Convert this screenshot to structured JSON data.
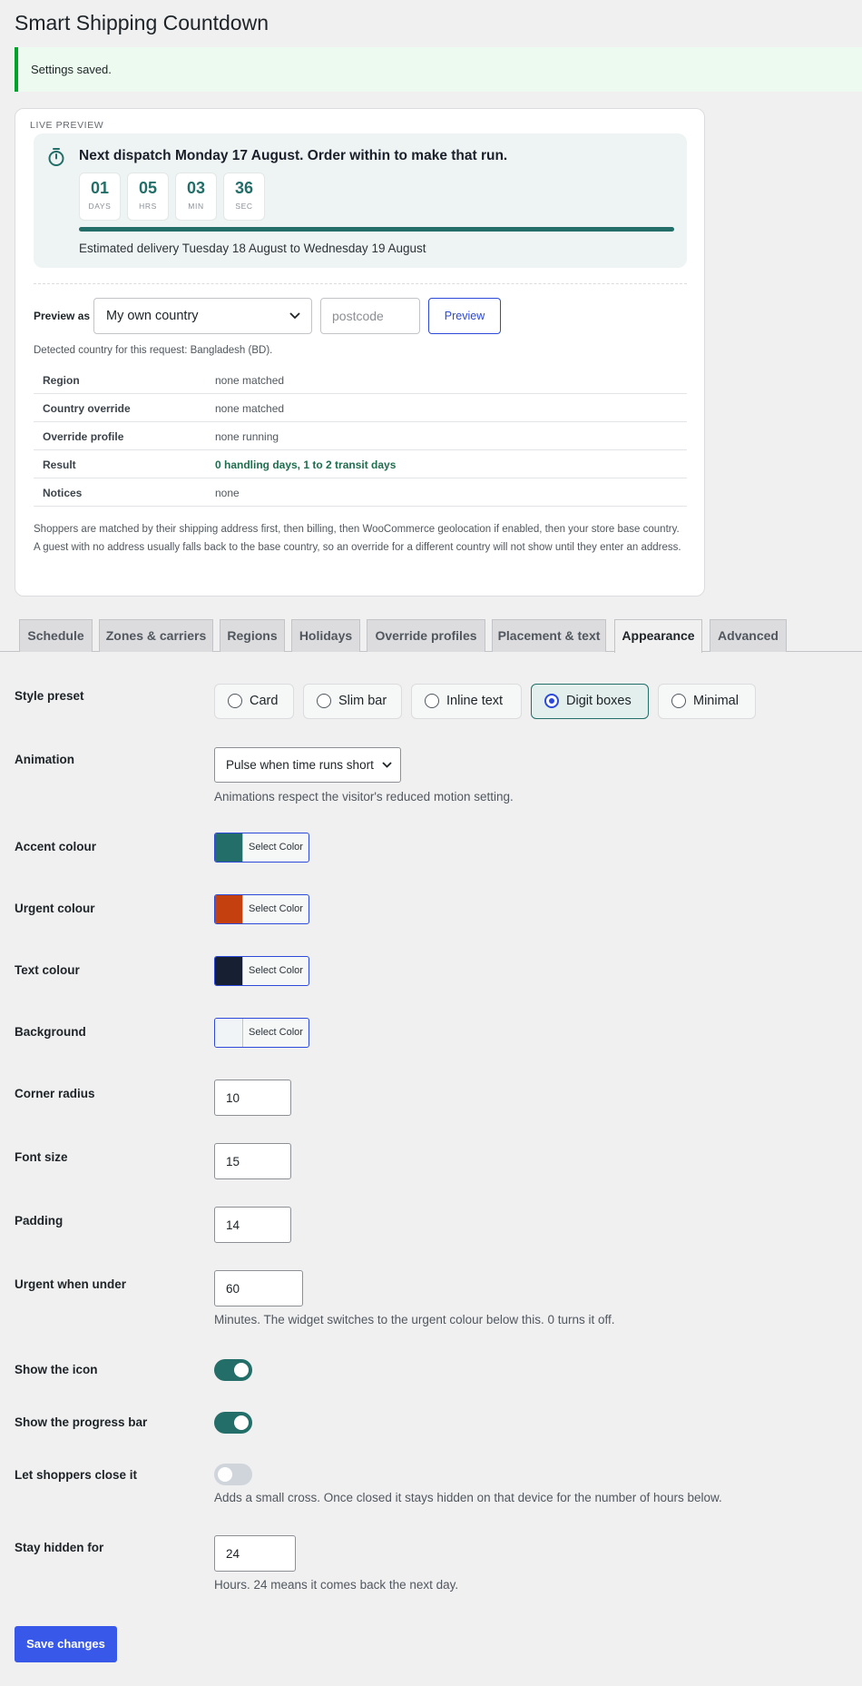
{
  "page": {
    "title": "Smart Shipping Countdown"
  },
  "notice": {
    "text": "Settings saved."
  },
  "preview": {
    "section_label": "LIVE PREVIEW",
    "headline": "Next dispatch Monday 17 August. Order within to make that run.",
    "countdown": [
      {
        "value": "01",
        "unit": "DAYS"
      },
      {
        "value": "05",
        "unit": "HRS"
      },
      {
        "value": "03",
        "unit": "MIN"
      },
      {
        "value": "36",
        "unit": "SEC"
      }
    ],
    "progress_percent": 100,
    "estimate": "Estimated delivery Tuesday 18 August to Wednesday 19 August",
    "preview_as_label": "Preview as",
    "country_value": "My own country",
    "postcode_placeholder": "postcode",
    "preview_button": "Preview",
    "detected": "Detected country for this request: Bangladesh (BD).",
    "info": [
      {
        "key": "Region",
        "value": "none matched"
      },
      {
        "key": "Country override",
        "value": "none matched"
      },
      {
        "key": "Override profile",
        "value": "none running"
      },
      {
        "key": "Result",
        "value": "0 handling days, 1 to 2 transit days"
      },
      {
        "key": "Notices",
        "value": "none"
      }
    ],
    "footnote": "Shoppers are matched by their shipping address first, then billing, then WooCommerce geolocation if enabled, then your store base country. A guest with no address usually falls back to the base country, so an override for a different country will not show until they enter an address."
  },
  "tabs": [
    {
      "label": "Schedule"
    },
    {
      "label": "Zones & carriers"
    },
    {
      "label": "Regions"
    },
    {
      "label": "Holidays"
    },
    {
      "label": "Override profiles"
    },
    {
      "label": "Placement & text"
    },
    {
      "label": "Appearance",
      "active": true
    },
    {
      "label": "Advanced"
    }
  ],
  "settings": {
    "style_preset": {
      "label": "Style preset",
      "options": [
        "Card",
        "Slim bar",
        "Inline text",
        "Digit boxes",
        "Minimal"
      ],
      "selected": "Digit boxes"
    },
    "animation": {
      "label": "Animation",
      "value": "Pulse when time runs short",
      "help": "Animations respect the visitor's reduced motion setting."
    },
    "accent_colour": {
      "label": "Accent colour",
      "button": "Select Color",
      "color": "#236e68"
    },
    "urgent_colour": {
      "label": "Urgent colour",
      "button": "Select Color",
      "color": "#c4400f"
    },
    "text_colour": {
      "label": "Text colour",
      "button": "Select Color",
      "color": "#172033"
    },
    "background": {
      "label": "Background",
      "button": "Select Color",
      "color": "#f0f4f7"
    },
    "corner_radius": {
      "label": "Corner radius",
      "value": "10"
    },
    "font_size": {
      "label": "Font size",
      "value": "15"
    },
    "padding": {
      "label": "Padding",
      "value": "14"
    },
    "urgent_when_under": {
      "label": "Urgent when under",
      "value": "60",
      "help": "Minutes. The widget switches to the urgent colour below this. 0 turns it off."
    },
    "show_icon": {
      "label": "Show the icon",
      "on": true
    },
    "show_progress": {
      "label": "Show the progress bar",
      "on": true
    },
    "let_close": {
      "label": "Let shoppers close it",
      "on": false,
      "help": "Adds a small cross. Once closed it stays hidden on that device for the number of hours below."
    },
    "stay_hidden": {
      "label": "Stay hidden for",
      "value": "24",
      "help": "Hours. 24 means it comes back the next day."
    }
  },
  "save_button": "Save changes",
  "icons": [
    "stopwatch-icon",
    "chevron-down-icon"
  ]
}
